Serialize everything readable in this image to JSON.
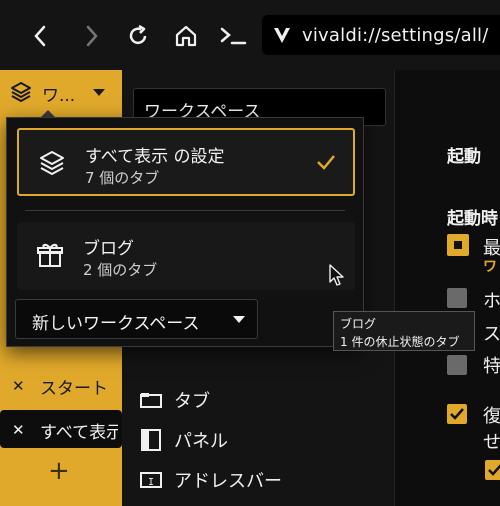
{
  "toolbar": {
    "address": "vivaldi://settings/all/"
  },
  "workspace_switcher": {
    "label": "ワ..."
  },
  "tabs": [
    {
      "title": "スタート"
    },
    {
      "title": "すべて表示"
    }
  ],
  "settings": {
    "search_value": "ワークスペース",
    "nav": [
      {
        "label": "タブ",
        "icon": "tab-icon"
      },
      {
        "label": "パネル",
        "icon": "panel-icon"
      },
      {
        "label": "アドレスバー",
        "icon": "address-bar-icon"
      }
    ],
    "right": {
      "section_title": "起動",
      "subsection_title": "起動時",
      "row1": "最",
      "row1b": "ワ",
      "row2": "ホ",
      "row3": "ス",
      "row4": "特",
      "row5": "復",
      "row5b": "せ"
    }
  },
  "popup": {
    "workspaces": [
      {
        "name": "すべて表示 の設定",
        "count": "7 個のタブ",
        "selected": true
      },
      {
        "name": "ブログ",
        "count": "2 個のタブ",
        "selected": false
      }
    ],
    "new_workspace_label": "新しいワークスペース"
  },
  "tooltip": {
    "line1": "ブログ",
    "line2": "1 件の休止状態のタブ"
  },
  "colors": {
    "accent": "#e0a92b",
    "background": "#121212"
  }
}
